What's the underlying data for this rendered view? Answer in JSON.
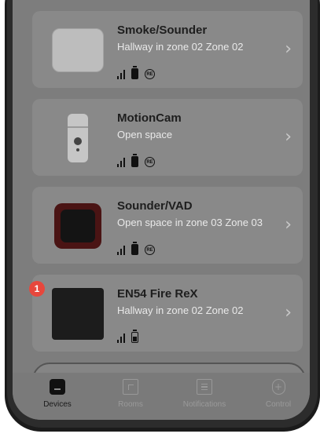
{
  "devices": [
    {
      "name": "Smoke/Sounder",
      "location": "Hallway in zone 02 Zone 02",
      "battery": "full",
      "has_re": true
    },
    {
      "name": "MotionCam",
      "location": "Open space",
      "battery": "full",
      "has_re": true
    },
    {
      "name": "Sounder/VAD",
      "location": "Open space in zone 03 Zone 03",
      "battery": "full",
      "has_re": true
    },
    {
      "name": "EN54 Fire ReX",
      "location": "Hallway in zone 02 Zone 02",
      "battery": "partial",
      "has_re": false
    }
  ],
  "re_label": "RE",
  "chevron": "›",
  "alert_badge": "1",
  "tabs": [
    {
      "label": "Devices",
      "icon": "devices-icon",
      "active": true
    },
    {
      "label": "Rooms",
      "icon": "rooms-icon",
      "active": false
    },
    {
      "label": "Notifications",
      "icon": "notifications-icon",
      "active": false
    },
    {
      "label": "Control",
      "icon": "control-icon",
      "active": false
    }
  ],
  "colors": {
    "badge": "#e7473c",
    "overlay": "#7d7d7d"
  }
}
